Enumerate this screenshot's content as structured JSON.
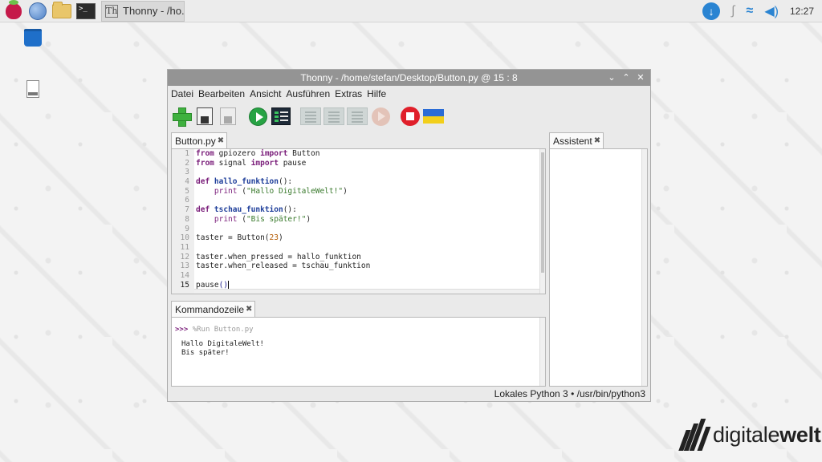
{
  "taskbar": {
    "task_label": "Thonny - /ho...",
    "thonny_glyph": "Th",
    "terminal_glyph": ">_",
    "clock": "12:27"
  },
  "window": {
    "title": "Thonny  -  /home/stefan/Desktop/Button.py  @  15 : 8",
    "controls": [
      "⌄",
      "⌃",
      "✕"
    ],
    "menu": [
      "Datei",
      "Bearbeiten",
      "Ansicht",
      "Ausführen",
      "Extras",
      "Hilfe"
    ],
    "editor_tab": "Button.py",
    "shell_tab": "Kommandozeile",
    "assist_tab": "Assistent",
    "status": "Lokales Python 3  •  /usr/bin/python3"
  },
  "code": [
    {
      "n": "1",
      "html": "<span class='kw'>from</span> gpiozero <span class='kw'>import</span> Button"
    },
    {
      "n": "2",
      "html": "<span class='kw'>from</span> signal <span class='kw'>import</span> pause"
    },
    {
      "n": "3",
      "html": ""
    },
    {
      "n": "4",
      "html": "<span class='kw'>def</span> <span class='defname'>hallo_funktion</span>():"
    },
    {
      "n": "5",
      "html": "    <span class='builtin'>print</span> (<span class='str'>\"Hallo DigitaleWelt!\"</span>)"
    },
    {
      "n": "6",
      "html": ""
    },
    {
      "n": "7",
      "html": "<span class='kw'>def</span> <span class='defname'>tschau_funktion</span>():"
    },
    {
      "n": "8",
      "html": "    <span class='builtin'>print</span> (<span class='str'>\"Bis später!\"</span>)"
    },
    {
      "n": "9",
      "html": ""
    },
    {
      "n": "10",
      "html": "taster = Button(<span class='num'>23</span>)"
    },
    {
      "n": "11",
      "html": ""
    },
    {
      "n": "12",
      "html": "taster.when_pressed = hallo_funktion"
    },
    {
      "n": "13",
      "html": "taster.when_released = tschau_funktion"
    },
    {
      "n": "14",
      "html": ""
    },
    {
      "n": "15",
      "html": "pause<span class='paren'>(</span><span class='paren'>)</span><span class='caret'></span>"
    }
  ],
  "current_line": "15",
  "shell": {
    "prompt": ">>>",
    "command": "%Run Button.py",
    "output": [
      "Hallo DigitaleWelt!",
      "Bis später!"
    ]
  },
  "brand": {
    "prefix": "digitale",
    "suffix": "welt"
  },
  "colors": {
    "keyword": "#7a1d7a",
    "function_name": "#1e3e9a",
    "string": "#3a7a2d",
    "number": "#b35a00",
    "titlebar": "#949494",
    "accent": "#2a84d2"
  }
}
